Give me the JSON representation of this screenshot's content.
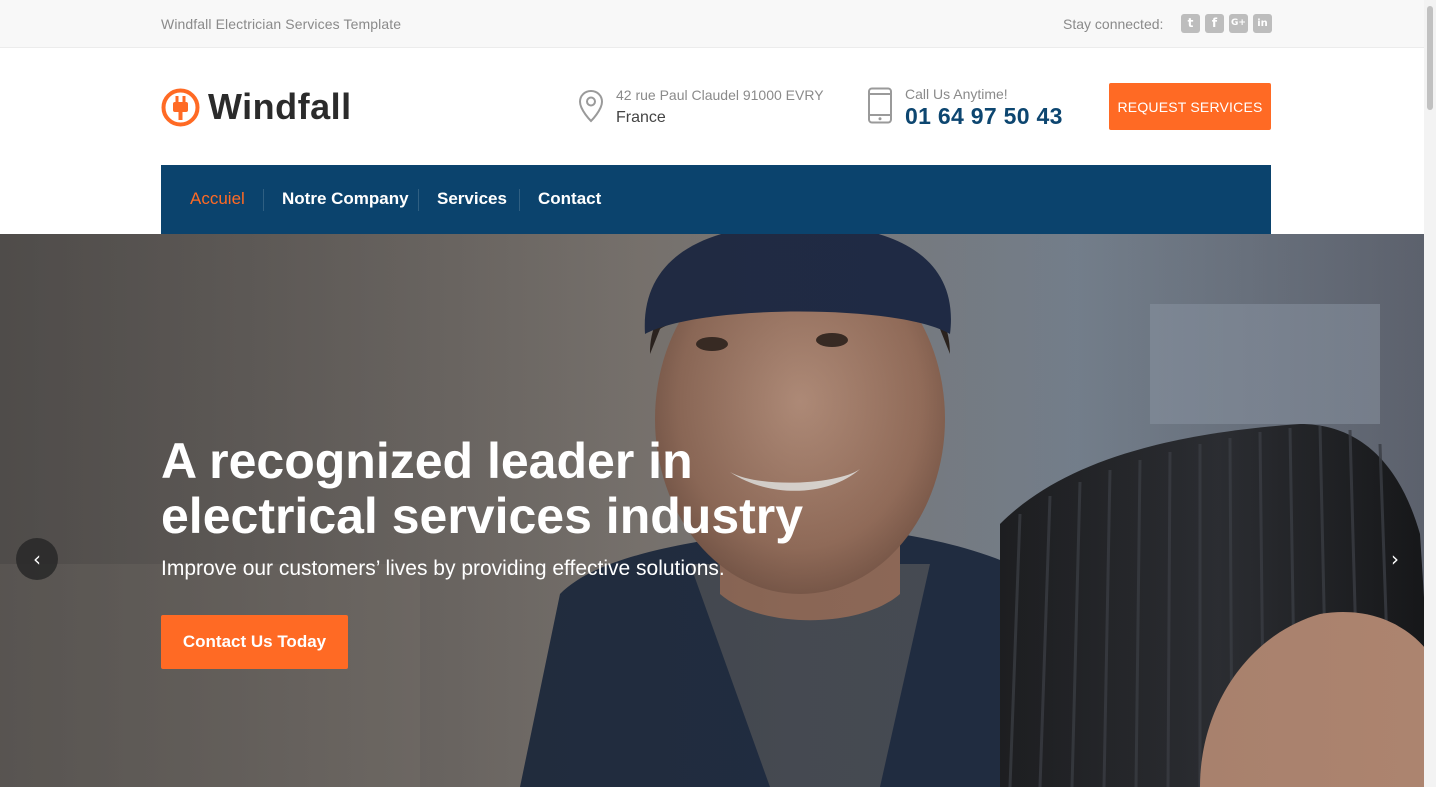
{
  "topbar": {
    "tagline": "Windfall Electrician Services Template",
    "stay_connected": "Stay connected:",
    "social": [
      {
        "icon": "twitter-icon",
        "glyph": "t"
      },
      {
        "icon": "facebook-icon",
        "glyph": "f"
      },
      {
        "icon": "google-plus-icon",
        "glyph": "G+"
      },
      {
        "icon": "linkedin-icon",
        "glyph": "in"
      }
    ]
  },
  "header": {
    "logo_text": "Windfall",
    "address_line1": "42 rue Paul Claudel 91000 EVRY",
    "address_line2": "France",
    "call_label": "Call Us Anytime!",
    "call_number": "01 64 97 50 43",
    "request_button": "REQUEST SERVICES"
  },
  "nav": {
    "items": [
      {
        "label": "Accuiel",
        "active": true
      },
      {
        "label": "Notre Company",
        "active": false
      },
      {
        "label": "Services",
        "active": false
      },
      {
        "label": "Contact",
        "active": false
      }
    ]
  },
  "hero": {
    "title": "A recognized leader in electrical services industry",
    "subtitle": "Improve our customers’ lives by providing effective solutions.",
    "cta": "Contact Us Today",
    "prev_glyph": "‹",
    "next_glyph": "›"
  },
  "colors": {
    "accent": "#ff6a24",
    "nav_bg": "#0b436d",
    "phone_text": "#0d4670"
  }
}
